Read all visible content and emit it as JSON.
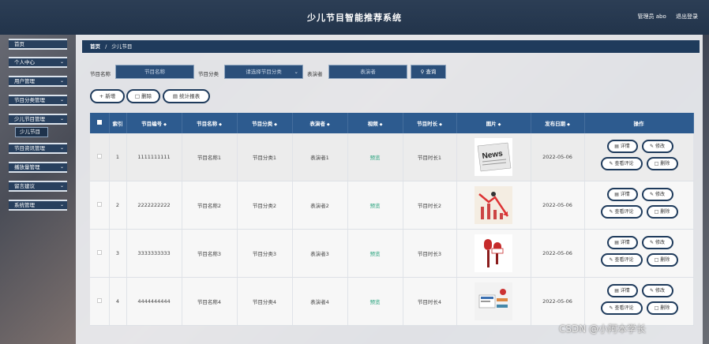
{
  "header": {
    "title": "少儿节目智能推荐系统",
    "admin_label": "管理员 abo",
    "logout_label": "退出登录"
  },
  "sidebar": {
    "items": [
      {
        "label": "首页",
        "has_chevron": false
      },
      {
        "label": "个人中心",
        "has_chevron": true
      },
      {
        "label": "用户管理",
        "has_chevron": true
      },
      {
        "label": "节目分类管理",
        "has_chevron": true
      },
      {
        "label": "少儿节目管理",
        "has_chevron": true
      },
      {
        "label": "节目资讯管理",
        "has_chevron": true
      },
      {
        "label": "播放量管理",
        "has_chevron": true
      },
      {
        "label": "留言建议",
        "has_chevron": true
      },
      {
        "label": "系统管理",
        "has_chevron": true
      }
    ],
    "active_sub": "少儿节目"
  },
  "breadcrumb": {
    "home": "首页",
    "sep": "/",
    "current": "少儿节目"
  },
  "filters": {
    "name_label": "节目名称",
    "name_placeholder": "节目名称",
    "category_label": "节目分类",
    "category_placeholder": "请选择节目分类",
    "performer_label": "表演者",
    "performer_placeholder": "表演者",
    "search_label": "查询"
  },
  "actions": {
    "add": "新增",
    "delete": "删除",
    "report": "统计报表"
  },
  "table": {
    "columns": [
      "索引",
      "节目编号",
      "节目名称",
      "节目分类",
      "表演者",
      "视频",
      "节目时长",
      "图片",
      "发布日期",
      "操作"
    ],
    "rows": [
      {
        "index": "1",
        "code": "1111111111",
        "name": "节目名称1",
        "category": "节目分类1",
        "performer": "表演者1",
        "video": "预览",
        "duration": "节目时长1",
        "image": "newspaper",
        "date": "2022-05-06"
      },
      {
        "index": "2",
        "code": "2222222222",
        "name": "节目名称2",
        "category": "节目分类2",
        "performer": "表演者2",
        "video": "预览",
        "duration": "节目时长2",
        "image": "chart-arrow",
        "date": "2022-05-06"
      },
      {
        "index": "3",
        "code": "3333333333",
        "name": "节目名称3",
        "category": "节目分类3",
        "performer": "表演者3",
        "video": "预览",
        "duration": "节目时长3",
        "image": "microphones",
        "date": "2022-05-06"
      },
      {
        "index": "4",
        "code": "4444444444",
        "name": "节目名称4",
        "category": "节目分类4",
        "performer": "表演者4",
        "video": "预览",
        "duration": "节目时长4",
        "image": "news-desk",
        "date": "2022-05-06"
      }
    ],
    "row_ops": {
      "detail": "详情",
      "edit": "修改",
      "comments": "查看评论",
      "delete": "删除"
    }
  },
  "watermark": "CSDN @小阿本学长"
}
